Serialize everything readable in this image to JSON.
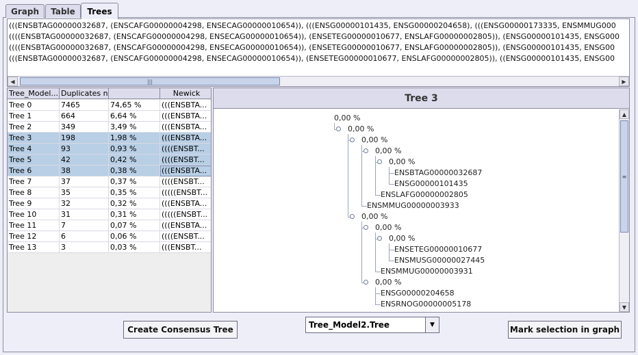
{
  "tabs": [
    "Graph",
    "Table",
    "Trees"
  ],
  "newick_lines": [
    "(((ENSBTAG00000032687, (ENSCAFG00000004298, ENSECAG00000010654)), (((ENSG00000101435, ENSG00000204658), (((ENSG00000173335, ENSMMUG000",
    "((((ENSBTAG00000032687, (ENSCAFG00000004298, ENSECAG00000010654)), (ENSETEG00000010677, ENSLAFG00000002805)), (ENSG00000101435, ENSG000",
    "((((ENSBTAG00000032687, (ENSCAFG00000004298, ENSECAG00000010654)), (ENSETEG00000010677, ENSLAFG00000002805)), (ENSG00000101435, ENSG00",
    "(((ENSBTAG00000032687, (ENSCAFG00000004298, ENSECAG00000010654)), (ENSETEG00000010677, ENSLAFG00000002805)), ((ENSG00000101435, ENSG00"
  ],
  "table": {
    "headers": [
      "Tree_Model...",
      "Duplicates n",
      "",
      "Newick"
    ],
    "rows": [
      {
        "name": "Tree 0",
        "dup": "7465",
        "pct": "74,65 %",
        "newick": "(((ENSBTA..."
      },
      {
        "name": "Tree 1",
        "dup": "664",
        "pct": "6,64 %",
        "newick": "(((ENSBTA..."
      },
      {
        "name": "Tree 2",
        "dup": "349",
        "pct": "3,49 %",
        "newick": "(((ENSBTA..."
      },
      {
        "name": "Tree 3",
        "dup": "198",
        "pct": "1,98 %",
        "newick": "(((ENSBTA..."
      },
      {
        "name": "Tree 4",
        "dup": "93",
        "pct": "0,93 %",
        "newick": "((((ENSBT..."
      },
      {
        "name": "Tree 5",
        "dup": "42",
        "pct": "0,42 %",
        "newick": "((((ENSBT..."
      },
      {
        "name": "Tree 6",
        "dup": "38",
        "pct": "0,38 %",
        "newick": "(((ENSBTA..."
      },
      {
        "name": "Tree 7",
        "dup": "37",
        "pct": "0,37 %",
        "newick": "((((ENSBT..."
      },
      {
        "name": "Tree 8",
        "dup": "35",
        "pct": "0,35 %",
        "newick": "(((((ENSBT..."
      },
      {
        "name": "Tree 9",
        "dup": "32",
        "pct": "0,32 %",
        "newick": "(((ENSBTA..."
      },
      {
        "name": "Tree 10",
        "dup": "31",
        "pct": "0,31 %",
        "newick": "(((((ENSBT..."
      },
      {
        "name": "Tree 11",
        "dup": "7",
        "pct": "0,07 %",
        "newick": "(((ENSBTA..."
      },
      {
        "name": "Tree 12",
        "dup": "6",
        "pct": "0,06 %",
        "newick": "((((ENSBT..."
      },
      {
        "name": "Tree 13",
        "dup": "3",
        "pct": "0,03 %",
        "newick": "(((ENSBT..."
      }
    ]
  },
  "tree": {
    "title": "Tree 3",
    "nodes": [
      {
        "label": "0,00 %",
        "depth": 0
      },
      {
        "label": "0,00 %",
        "depth": 1
      },
      {
        "label": "0,00 %",
        "depth": 2
      },
      {
        "label": "0,00 %",
        "depth": 3
      },
      {
        "label": "0,00 %",
        "depth": 4
      },
      {
        "label": "ENSBTAG00000032687",
        "depth": 5,
        "leaf": true
      },
      {
        "label": "ENSG00000101435",
        "depth": 5,
        "leaf": true
      },
      {
        "label": "ENSLAFG00000002805",
        "depth": 4,
        "leaf": true
      },
      {
        "label": "ENSMMUG00000003933",
        "depth": 3,
        "leaf": true
      },
      {
        "label": "0,00 %",
        "depth": 2
      },
      {
        "label": "0,00 %",
        "depth": 3
      },
      {
        "label": "0,00 %",
        "depth": 4
      },
      {
        "label": "ENSETEG00000010677",
        "depth": 5,
        "leaf": true
      },
      {
        "label": "ENSMUSG00000027445",
        "depth": 5,
        "leaf": true
      },
      {
        "label": "ENSMMUG00000003931",
        "depth": 4,
        "leaf": true
      },
      {
        "label": "0,00 %",
        "depth": 3
      },
      {
        "label": "ENSG00000204658",
        "depth": 4,
        "leaf": true
      },
      {
        "label": "ENSRNOG00000005178",
        "depth": 4,
        "leaf": true
      }
    ]
  },
  "buttons": {
    "consensus": "Create Consensus Tree",
    "mark": "Mark selection in graph"
  },
  "combo": {
    "value": "Tree_Model2.Tree"
  },
  "selected_rows": [
    3,
    4,
    5,
    6
  ]
}
